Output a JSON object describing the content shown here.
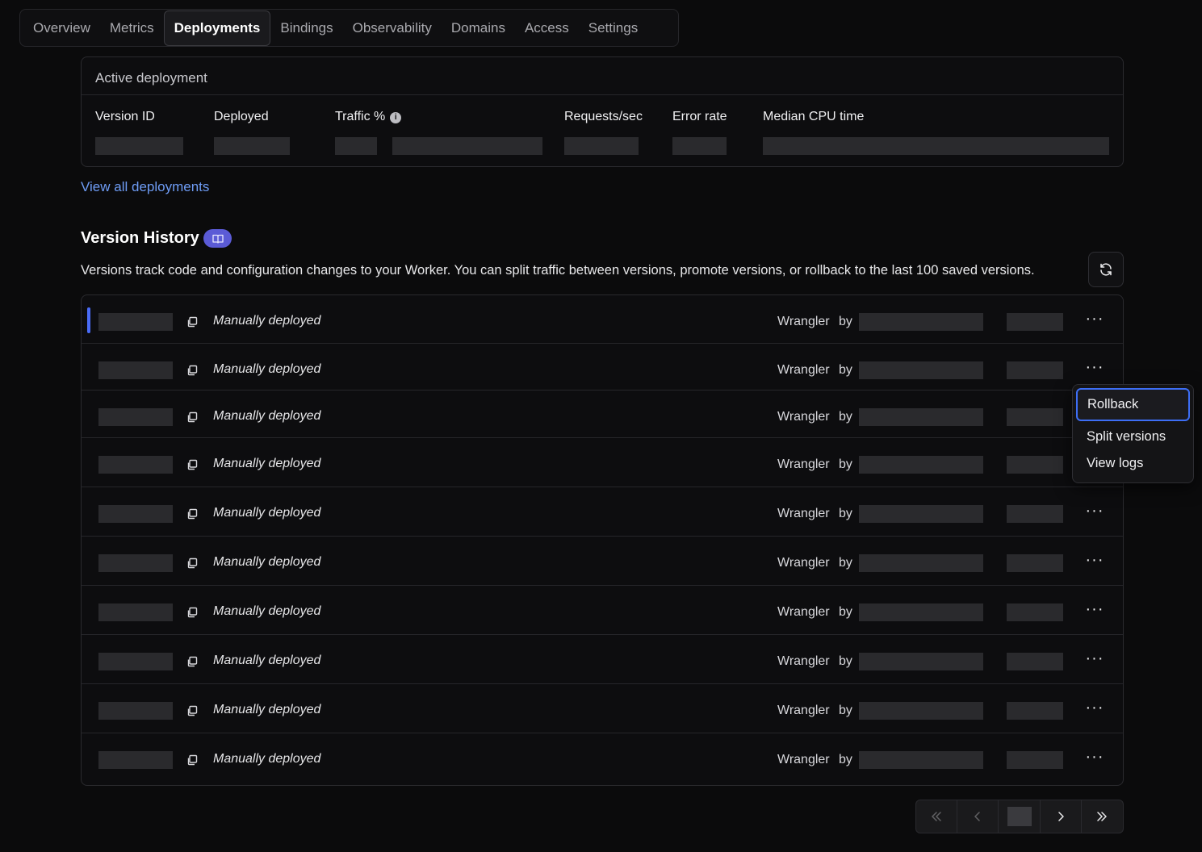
{
  "tabs": [
    {
      "label": "Overview"
    },
    {
      "label": "Metrics"
    },
    {
      "label": "Deployments",
      "active": true
    },
    {
      "label": "Bindings"
    },
    {
      "label": "Observability"
    },
    {
      "label": "Domains"
    },
    {
      "label": "Access"
    },
    {
      "label": "Settings"
    }
  ],
  "active_deployment": {
    "title": "Active deployment",
    "columns": {
      "version_id": "Version ID",
      "deployed": "Deployed",
      "traffic": "Traffic %",
      "requests": "Requests/sec",
      "error_rate": "Error rate",
      "median_cpu": "Median CPU time"
    },
    "info_icon": "i"
  },
  "view_all_link": "View all deployments",
  "version_history": {
    "title": "Version History",
    "badge_icon": "book-icon",
    "description": "Versions track code and configuration changes to your Worker. You can split traffic between versions, promote versions, or rollback to the last 100 saved versions.",
    "refresh_icon": "refresh-icon",
    "rows": [
      {
        "message": "Manually deployed",
        "source": "Wrangler",
        "by": "by",
        "active": true
      },
      {
        "message": "Manually deployed",
        "source": "Wrangler",
        "by": "by"
      },
      {
        "message": "Manually deployed",
        "source": "Wrangler",
        "by": "by"
      },
      {
        "message": "Manually deployed",
        "source": "Wrangler",
        "by": "by"
      },
      {
        "message": "Manually deployed",
        "source": "Wrangler",
        "by": "by"
      },
      {
        "message": "Manually deployed",
        "source": "Wrangler",
        "by": "by"
      },
      {
        "message": "Manually deployed",
        "source": "Wrangler",
        "by": "by"
      },
      {
        "message": "Manually deployed",
        "source": "Wrangler",
        "by": "by"
      },
      {
        "message": "Manually deployed",
        "source": "Wrangler",
        "by": "by"
      },
      {
        "message": "Manually deployed",
        "source": "Wrangler",
        "by": "by"
      }
    ],
    "more_label": "···"
  },
  "context_menu": {
    "items": [
      "Rollback",
      "Split versions",
      "View logs"
    ]
  },
  "colors": {
    "accent": "#4a6cf7",
    "link": "#6e9cf5",
    "badge": "#5b5bd6"
  }
}
